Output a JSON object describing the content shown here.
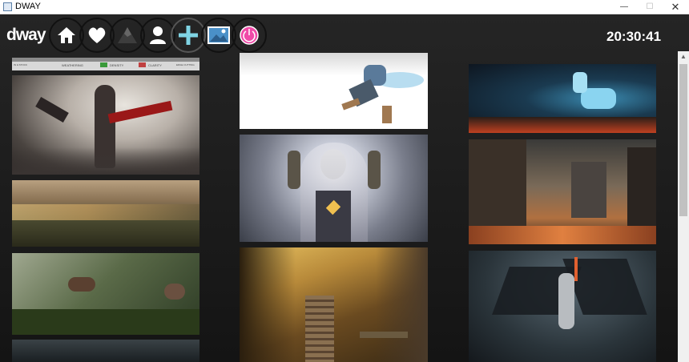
{
  "window": {
    "title": "DWAY",
    "min_glyph": "—",
    "max_glyph": "☐",
    "close_glyph": "✕"
  },
  "header": {
    "logo": "dway",
    "clock": "20:30:41"
  },
  "nav": [
    {
      "name": "home-button",
      "icon": "home-icon",
      "color": "#0f0f0f"
    },
    {
      "name": "favorites-button",
      "icon": "heart-icon",
      "color": "#d95f5f"
    },
    {
      "name": "explore-button",
      "icon": "mountain-icon",
      "color": "#2ecc8e"
    },
    {
      "name": "profile-button",
      "icon": "user-icon",
      "color": "#2fb5a0"
    },
    {
      "name": "add-button",
      "icon": "plus-icon",
      "color": "#1a1a1a"
    },
    {
      "name": "gallery-button",
      "icon": "image-icon",
      "color": "#e6a55a"
    },
    {
      "name": "power-button",
      "icon": "power-icon",
      "color": "#e8379a"
    }
  ],
  "spec_strip": {
    "cells": [
      "WEATHERING",
      "DENSITY",
      "CLARITY"
    ],
    "small": [
      "IN & STOCK",
      "EDGE CUTTING"
    ]
  },
  "gallery": [
    {
      "name": "wallpaper-assassin",
      "colors": [
        "#4a4a4a",
        "#c8c0b8",
        "#8b1a1a"
      ]
    },
    {
      "name": "wallpaper-valley",
      "colors": [
        "#3a3020",
        "#8b7355",
        "#c9a060"
      ]
    },
    {
      "name": "wallpaper-forest-creature",
      "colors": [
        "#2c3a24",
        "#6b7a4a",
        "#a0a890"
      ]
    },
    {
      "name": "wallpaper-dark-bottom",
      "colors": [
        "#1a1f22",
        "#3a4246",
        "#2a3034"
      ]
    },
    {
      "name": "wallpaper-airbender",
      "colors": [
        "#ffffff",
        "#e6e8ea",
        "#8aa6c0"
      ]
    },
    {
      "name": "wallpaper-goddess",
      "colors": [
        "#2a2e38",
        "#9ea4b4",
        "#e0c070"
      ]
    },
    {
      "name": "wallpaper-autumn-stairs",
      "colors": [
        "#3a2a14",
        "#b88a3a",
        "#e6c060"
      ]
    },
    {
      "name": "wallpaper-ice-stag",
      "colors": [
        "#0e1620",
        "#3a8ab0",
        "#c04020"
      ]
    },
    {
      "name": "wallpaper-ruins",
      "colors": [
        "#2a2420",
        "#7a6a58",
        "#c06030"
      ]
    },
    {
      "name": "wallpaper-dark-angel",
      "colors": [
        "#1a2026",
        "#3a4a54",
        "#b83020"
      ]
    }
  ]
}
